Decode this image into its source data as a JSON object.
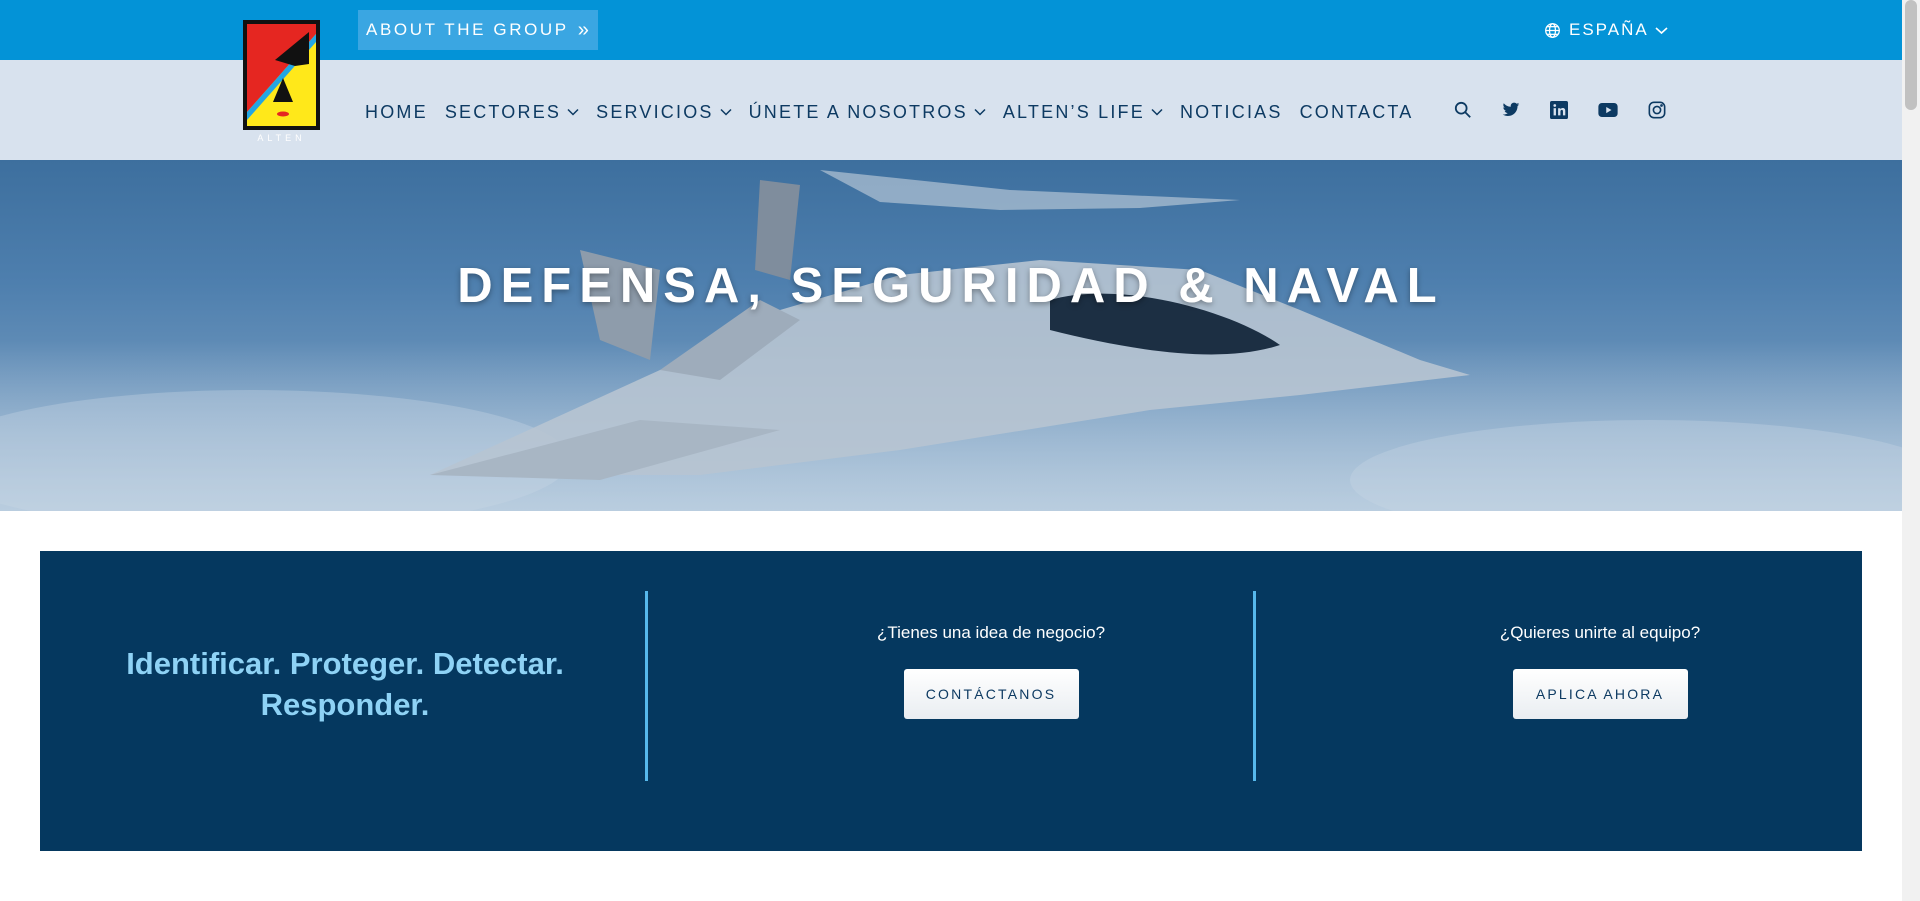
{
  "topbar": {
    "about_label": "ABOUT THE GROUP",
    "language_label": "ESPAÑA"
  },
  "logo": {
    "alt": "ALTEN"
  },
  "nav": {
    "items": [
      {
        "label": "HOME",
        "dropdown": false
      },
      {
        "label": "SECTORES",
        "dropdown": true
      },
      {
        "label": "SERVICIOS",
        "dropdown": true
      },
      {
        "label": "ÚNETE A NOSOTROS",
        "dropdown": true
      },
      {
        "label": "ALTEN’S LIFE",
        "dropdown": true
      },
      {
        "label": "NOTICIAS",
        "dropdown": false
      },
      {
        "label": "CONTACTA",
        "dropdown": false
      }
    ],
    "icons": [
      "search-icon",
      "twitter-icon",
      "linkedin-icon",
      "youtube-icon",
      "instagram-icon"
    ]
  },
  "hero": {
    "title": "DEFENSA, SEGURIDAD & NAVAL"
  },
  "cta": {
    "tagline": "Identificar. Proteger. Detectar. Responder.",
    "columns": [
      {
        "question": "¿Tienes una idea de negocio?",
        "button": "CONTÁCTANOS"
      },
      {
        "question": "¿Quieres unirte al equipo?",
        "button": "APLICA AHORA"
      }
    ]
  },
  "colors": {
    "topbar": "#0393d7",
    "navbar": "#d8e2ee",
    "nav_text": "#0d3a62",
    "cta_bg": "#05385f",
    "tagline": "#8ed2f5",
    "divider": "#56b8ec"
  }
}
